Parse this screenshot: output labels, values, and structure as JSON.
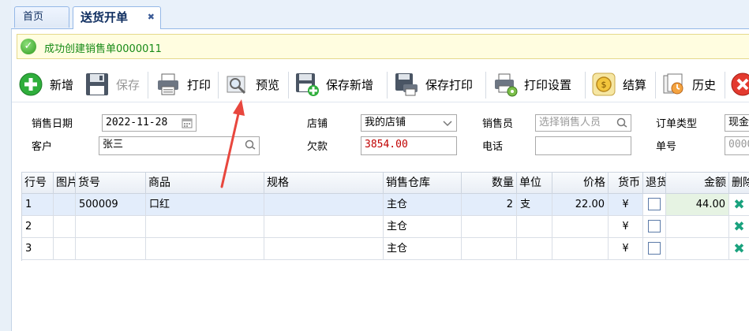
{
  "tabs": {
    "home": "首页",
    "active": "送货开单",
    "close": "✖"
  },
  "message": {
    "text": "成功创建销售单0000011"
  },
  "toolbar": {
    "add": "新增",
    "save": "保存",
    "print": "打印",
    "preview": "预览",
    "save_new": "保存新增",
    "save_print": "保存打印",
    "print_settings": "打印设置",
    "checkout": "结算",
    "history": "历史"
  },
  "form": {
    "sale_date_label": "销售日期",
    "sale_date_value": "2022-11-28",
    "store_label": "店铺",
    "store_value": "我的店铺",
    "salesperson_label": "销售员",
    "salesperson_placeholder": "选择销售人员",
    "order_type_label": "订单类型",
    "order_type_value": "现金",
    "customer_label": "客户",
    "customer_value": "张三",
    "debt_label": "欠款",
    "debt_value": "3854.00",
    "phone_label": "电话",
    "phone_value": "",
    "order_no_label": "单号",
    "order_no_value": "0000"
  },
  "grid": {
    "headers": {
      "row": "行号",
      "image": "图片",
      "code": "货号",
      "product": "商品",
      "spec": "规格",
      "warehouse": "销售仓库",
      "qty": "数量",
      "unit": "单位",
      "price": "价格",
      "currency": "货币",
      "return": "退货",
      "amount": "金额",
      "delete": "删除"
    },
    "rows": [
      {
        "row": "1",
        "code": "500009",
        "product": "口红",
        "spec": "",
        "warehouse": "主仓",
        "qty": "2",
        "unit": "支",
        "price": "22.00",
        "currency": "¥",
        "amount": "44.00"
      },
      {
        "row": "2",
        "code": "",
        "product": "",
        "spec": "",
        "warehouse": "主仓",
        "qty": "",
        "unit": "",
        "price": "",
        "currency": "¥",
        "amount": ""
      },
      {
        "row": "3",
        "code": "",
        "product": "",
        "spec": "",
        "warehouse": "主仓",
        "qty": "",
        "unit": "",
        "price": "",
        "currency": "¥",
        "amount": ""
      }
    ]
  },
  "colors": {
    "annotation_arrow": "#e8473e",
    "success_text": "#168a16",
    "debt_text": "#c00000"
  }
}
